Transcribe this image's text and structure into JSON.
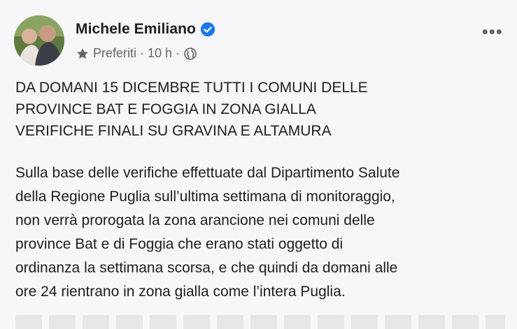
{
  "post": {
    "author": "Michele Emiliano",
    "meta": {
      "audience": "Preferiti",
      "separator": "·",
      "time": "10 h",
      "separator2": "·"
    },
    "headline_lines": [
      "DA DOMANI 15 DICEMBRE TUTTI I COMUNI DELLE",
      "PROVINCE BAT E FOGGIA IN ZONA GIALLA",
      "VERIFICHE FINALI SU GRAVINA E ALTAMURA"
    ],
    "body_lines": [
      "Sulla base delle verifiche effettuate dal Dipartimento Salute",
      "della Regione Puglia sull’ultima settimana di monitoraggio,",
      "non verrà prorogata la zona arancione nei comuni delle",
      "province Bat e di Foggia che erano stati oggetto di",
      "ordinanza la settimana scorsa, e che quindi da domani alle",
      "ore 24 rientrano in zona gialla come l’intera Puglia."
    ],
    "more_label": "•••"
  },
  "icons": {
    "verified": "verified-badge-icon",
    "star": "star-icon",
    "globe": "globe-icon",
    "more": "more-options-icon"
  },
  "colors": {
    "verified_blue": "#1877f2",
    "secondary_text": "#65676b",
    "primary_text": "#1c1e21",
    "background": "#f7f7f9"
  }
}
